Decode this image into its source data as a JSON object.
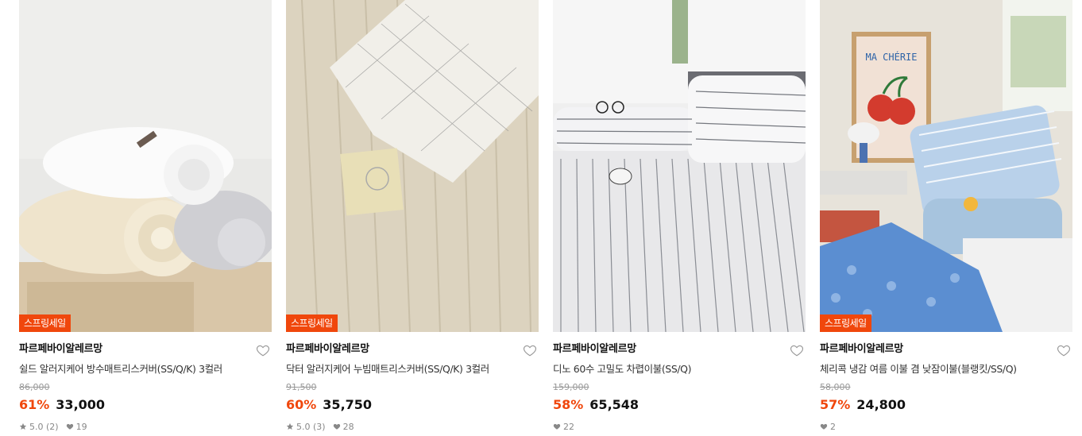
{
  "products": [
    {
      "badge": "스프링세일",
      "brand": "파르페바이알레르망",
      "name": "쉴드 알러지케어 방수매트리스커버(SS/Q/K) 3컬러",
      "original_price": "86,000",
      "discount": "61%",
      "price": "33,000",
      "rating": "5.0 (2)",
      "likes": "19",
      "image_icon": "rolled-sheets-image"
    },
    {
      "badge": "스프링세일",
      "brand": "파르페바이알레르망",
      "name": "닥터 알러지케어 누빔매트리스커버(SS/Q/K) 3컬러",
      "original_price": "91,500",
      "discount": "60%",
      "price": "35,750",
      "rating": "5.0 (3)",
      "likes": "28",
      "image_icon": "quilted-cover-image"
    },
    {
      "badge": "",
      "brand": "파르페바이알레르망",
      "name": "디노 60수 고밀도 차렵이불(SS/Q)",
      "original_price": "159,000",
      "discount": "58%",
      "price": "65,548",
      "rating": "",
      "likes": "22",
      "image_icon": "striped-comforter-image"
    },
    {
      "badge": "스프링세일",
      "brand": "파르페바이알레르망",
      "name": "체리콕 냉감 여름 이불 겸 낮잠이불(블랭킷/SS/Q)",
      "original_price": "58,000",
      "discount": "57%",
      "price": "24,800",
      "rating": "",
      "likes": "2",
      "image_icon": "cherry-blanket-image"
    }
  ],
  "poster_text": "MA CHÉRIE",
  "colors": {
    "accent": "#f0470c",
    "muted": "#999999"
  }
}
